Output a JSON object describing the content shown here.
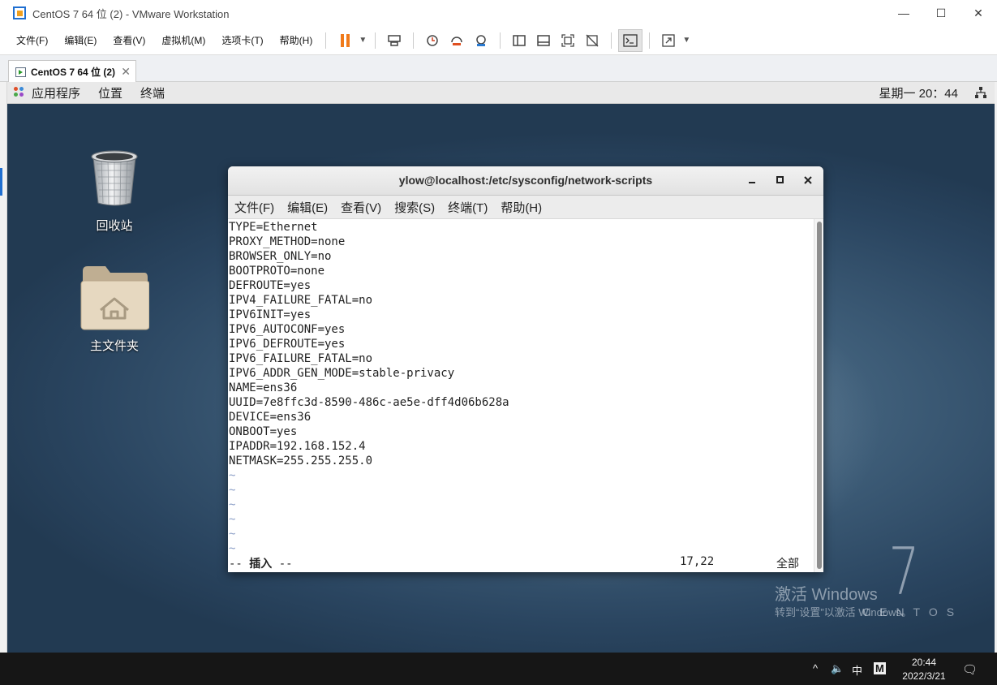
{
  "window": {
    "title": "CentOS 7 64 位 (2) - VMware Workstation",
    "minimize": "—",
    "maximize": "☐",
    "close": "✕"
  },
  "menubar": {
    "file": "文件(F)",
    "edit": "编辑(E)",
    "view": "查看(V)",
    "vm": "虚拟机(M)",
    "tabs": "选项卡(T)",
    "help": "帮助(H)"
  },
  "vm_tab": {
    "label": "CentOS 7 64 位 (2)"
  },
  "gnome": {
    "applications": "应用程序",
    "places": "位置",
    "terminal": "终端",
    "clock": "星期一 20：44"
  },
  "desktop": {
    "trash_label": "回收站",
    "home_label": "主文件夹",
    "activate_title": "激活 Windows",
    "activate_hint": "转到“设置”以激活 Windows。",
    "centos_version": "7",
    "centos_word": "CENTOS"
  },
  "terminal": {
    "title": "ylow@localhost:/etc/sysconfig/network-scripts",
    "menu": {
      "file": "文件(F)",
      "edit": "编辑(E)",
      "view": "查看(V)",
      "search": "搜索(S)",
      "terminal": "终端(T)",
      "help": "帮助(H)"
    },
    "lines": {
      "l1": "TYPE=Ethernet",
      "l2": "PROXY_METHOD=none",
      "l3": "BROWSER_ONLY=no",
      "l4": "BOOTPROTO=none",
      "l5": "DEFROUTE=yes",
      "l6": "IPV4_FAILURE_FATAL=no",
      "l7": "IPV6INIT=yes",
      "l8": "IPV6_AUTOCONF=yes",
      "l9": "IPV6_DEFROUTE=yes",
      "l10": "IPV6_FAILURE_FATAL=no",
      "l11": "IPV6_ADDR_GEN_MODE=stable-privacy",
      "l12": "NAME=ens36",
      "l13": "UUID=7e8ffc3d-8590-486c-ae5e-dff4d06b628a",
      "l14": "DEVICE=ens36",
      "l15": "ONBOOT=yes",
      "l16": "IPADDR=192.168.152.4",
      "l17": "NETMASK=255.255.255.0",
      "tilde": "~"
    },
    "status": {
      "mode_prefix": "-- ",
      "mode": "插入",
      "mode_suffix": " --",
      "position": "17,22",
      "scroll": "全部"
    }
  },
  "taskbar": {
    "chevron": "^",
    "volume": "🔈",
    "ime": "中",
    "ime_mode": "M",
    "time": "20:44",
    "date": "2022/3/21",
    "notification": "🗨"
  }
}
